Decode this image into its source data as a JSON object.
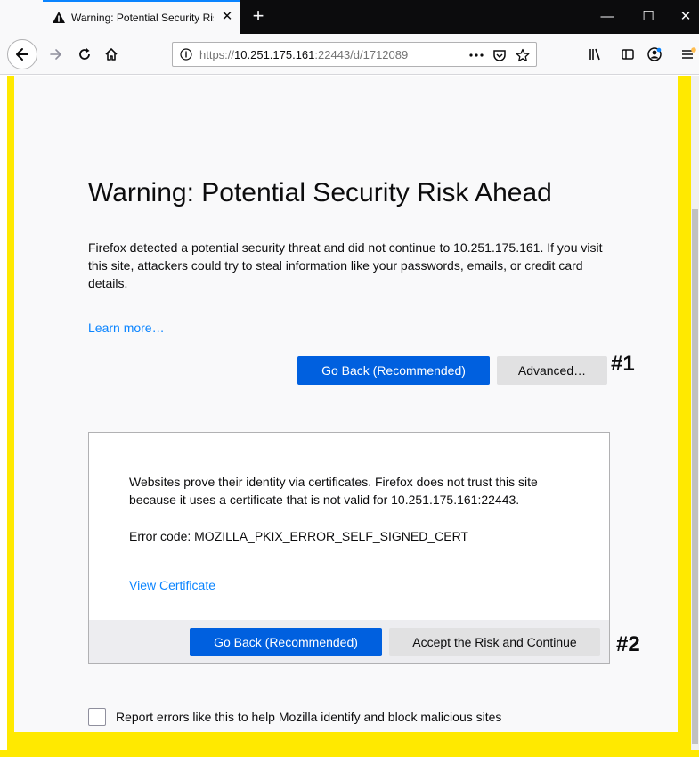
{
  "tab": {
    "title": "Warning: Potential Security Risk Ahead",
    "close_glyph": "✕",
    "new_tab_glyph": "+"
  },
  "window_controls": {
    "minimize": "—",
    "maximize": "☐",
    "close": "✕"
  },
  "url": {
    "scheme": "https://",
    "host": "10.251.175.161",
    "rest": ":22443/d/1712089"
  },
  "main": {
    "headline": "Warning: Potential Security Risk Ahead",
    "description": "Firefox detected a potential security threat and did not continue to 10.251.175.161. If you visit this site, attackers could try to steal information like your passwords, emails, or credit card details.",
    "learn_more": "Learn more…",
    "go_back": "Go Back (Recommended)",
    "advanced": "Advanced…"
  },
  "advanced_panel": {
    "text": "Websites prove their identity via certificates. Firefox does not trust this site because it uses a certificate that is not valid for 10.251.175.161:22443.",
    "error_code": "Error code: MOZILLA_PKIX_ERROR_SELF_SIGNED_CERT",
    "view_certificate": "View Certificate",
    "go_back": "Go Back (Recommended)",
    "accept": "Accept the Risk and Continue"
  },
  "report": {
    "label": "Report errors like this to help Mozilla identify and block malicious sites"
  },
  "annotations": {
    "label1": "#1",
    "label2": "#2"
  },
  "colors": {
    "highlight": "#ffe900",
    "primary_button": "#0060df",
    "link": "#0a84ff"
  }
}
